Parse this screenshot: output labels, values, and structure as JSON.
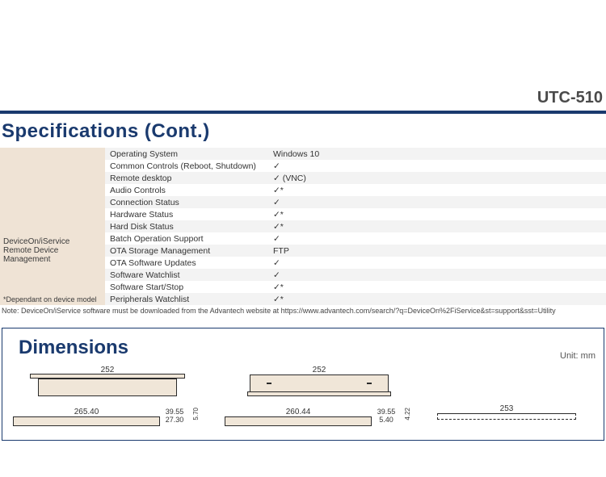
{
  "header": {
    "model": "UTC-510"
  },
  "specs": {
    "title": "Specifications (Cont.)",
    "category_line1": "DeviceOn/iService",
    "category_line2": "Remote Device Management",
    "category_foot": "*Dependant on device model",
    "rows": [
      {
        "k": "Operating System",
        "v": "Windows 10"
      },
      {
        "k": "Common Controls (Reboot, Shutdown)",
        "v": "✓"
      },
      {
        "k": "Remote desktop",
        "v": "✓ (VNC)"
      },
      {
        "k": "Audio Controls",
        "v": "✓*"
      },
      {
        "k": "Connection Status",
        "v": "✓"
      },
      {
        "k": "Hardware Status",
        "v": "✓*"
      },
      {
        "k": "Hard Disk Status",
        "v": "✓*"
      },
      {
        "k": "Batch Operation Support",
        "v": "✓"
      },
      {
        "k": "OTA Storage Management",
        "v": "FTP"
      },
      {
        "k": "OTA Software Updates",
        "v": "✓"
      },
      {
        "k": "Software Watchlist",
        "v": "✓"
      },
      {
        "k": "Software Start/Stop",
        "v": "✓*"
      },
      {
        "k": "Peripherals Watchlist",
        "v": "✓*"
      }
    ],
    "note": "Note: DeviceOn/iService software must be downloaded from the Advantech website at https://www.advantech.com/search/?q=DeviceOn%2FiService&st=support&sst=Utility"
  },
  "dimensions": {
    "title": "Dimensions",
    "unit_label": "Unit: mm",
    "values": {
      "top_left": "252",
      "top_right": "252",
      "row2_a": "265.40",
      "row2_b1": "39.55",
      "row2_b2": "27.30",
      "row2_b3": "5.70",
      "row2_c": "260.44",
      "row2_d1": "39.55",
      "row2_d2": "5.40",
      "row2_d3": "4.22",
      "row2_e": "253"
    }
  }
}
